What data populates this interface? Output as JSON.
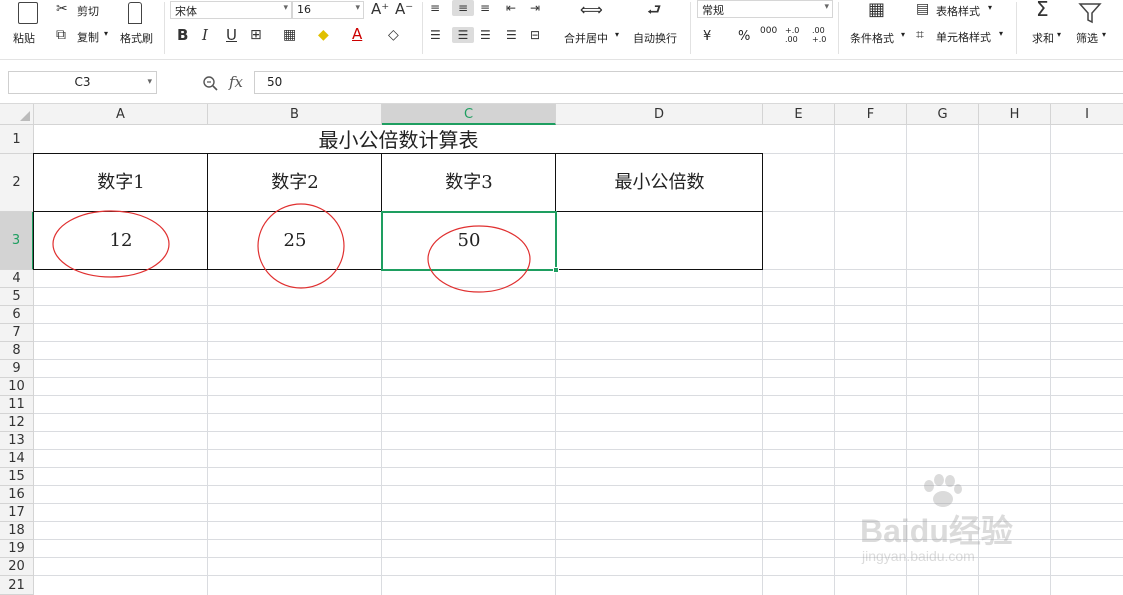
{
  "ribbon": {
    "clipboard": {
      "paste": "粘贴",
      "cut": "剪切",
      "copy": "复制",
      "format_painter": "格式刷"
    },
    "font": {
      "name": "宋体",
      "size": "16"
    },
    "alignment": {
      "merge_center": "合并居中",
      "wrap_text": "自动换行"
    },
    "number": {
      "format": "常规",
      "currency": "¥",
      "percent": "%",
      "thousands": "000",
      "inc_decimal": "+.0 .00",
      "dec_decimal": ".00 +.0"
    },
    "styles": {
      "conditional_format": "条件格式",
      "table_style": "表格样式",
      "cell_style": "单元格样式"
    },
    "editing": {
      "sum": "求和",
      "filter": "筛选"
    }
  },
  "formula_bar": {
    "name_box": "C3",
    "fx": "fx",
    "value": "50"
  },
  "sheet": {
    "columns": [
      "A",
      "B",
      "C",
      "D",
      "E",
      "F",
      "G",
      "H",
      "I"
    ],
    "selected_column": "C",
    "rows": [
      "1",
      "2",
      "3",
      "4",
      "5",
      "6",
      "7",
      "8",
      "9",
      "10",
      "11",
      "12",
      "13",
      "14",
      "15",
      "16",
      "17",
      "18",
      "19",
      "20",
      "21"
    ],
    "selected_row": "3",
    "title": "最小公倍数计算表",
    "headers": [
      "数字1",
      "数字2",
      "数字3",
      "最小公倍数"
    ],
    "values": [
      "12",
      "25",
      "50",
      ""
    ]
  },
  "watermark": {
    "brand": "Baidu经验",
    "url": "jingyan.baidu.com"
  },
  "colors": {
    "selection": "#1e9e60",
    "annotation": "#e03030"
  }
}
